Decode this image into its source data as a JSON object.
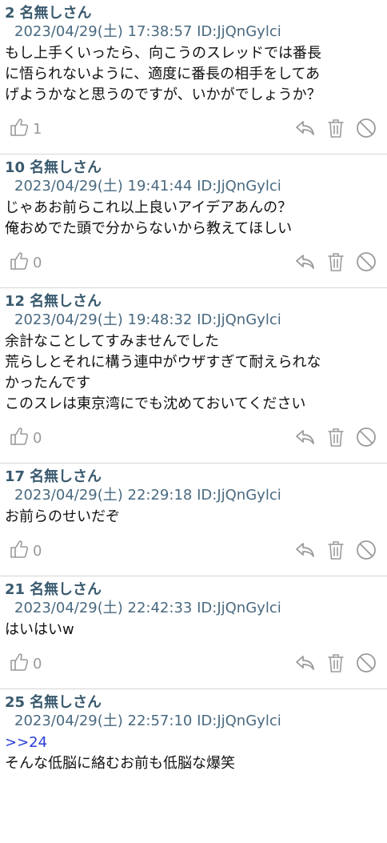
{
  "posts": [
    {
      "number": "2",
      "name": "名無しさん",
      "datetime": "2023/04/29(土) 17:38:57",
      "id": "ID:JjQnGylci",
      "body": [
        "もし上手くいったら、向こうのスレッドでは番長",
        "に悟られないように、適度に番長の相手をしてあ",
        "げようかなと思うのですが、いかがでしょうか？"
      ],
      "likes": "1"
    },
    {
      "number": "10",
      "name": "名無しさん",
      "datetime": "2023/04/29(土) 19:41:44",
      "id": "ID:JjQnGylci",
      "body": [
        "じゃあお前らこれ以上良いアイデアあんの？",
        "俺おめでた頭で分からないから教えてほしい"
      ],
      "likes": "0"
    },
    {
      "number": "12",
      "name": "名無しさん",
      "datetime": "2023/04/29(土) 19:48:32",
      "id": "ID:JjQnGylci",
      "body": [
        "余計なことしてすみませんでした",
        "荒らしとそれに構う連中がウザすぎて耐えられな",
        "かったんです",
        "このスレは東京湾にでも沈めておいてください"
      ],
      "likes": "0"
    },
    {
      "number": "17",
      "name": "名無しさん",
      "datetime": "2023/04/29(土) 22:29:18",
      "id": "ID:JjQnGylci",
      "body": [
        "お前らのせいだぞ"
      ],
      "likes": "0"
    },
    {
      "number": "21",
      "name": "名無しさん",
      "datetime": "2023/04/29(土) 22:42:33",
      "id": "ID:JjQnGylci",
      "body": [
        "はいはいw"
      ],
      "likes": "0"
    },
    {
      "number": "25",
      "name": "名無しさん",
      "datetime": "2023/04/29(土) 22:57:10",
      "id": "ID:JjQnGylci",
      "reply_to": ">>24",
      "body": [
        "そんな低脳に絡むお前も低脳な爆笑"
      ],
      "likes": null
    }
  ],
  "icons": {
    "like": "thumbs-up-icon",
    "reply": "reply-arrow-icon",
    "delete": "trash-icon",
    "block": "block-icon"
  },
  "colors": {
    "header": "#3a5a6e",
    "meta": "#4a6a80",
    "reply_link": "#2a3fd6",
    "icon": "#9a9a9a",
    "divider": "#d6d6d6"
  }
}
